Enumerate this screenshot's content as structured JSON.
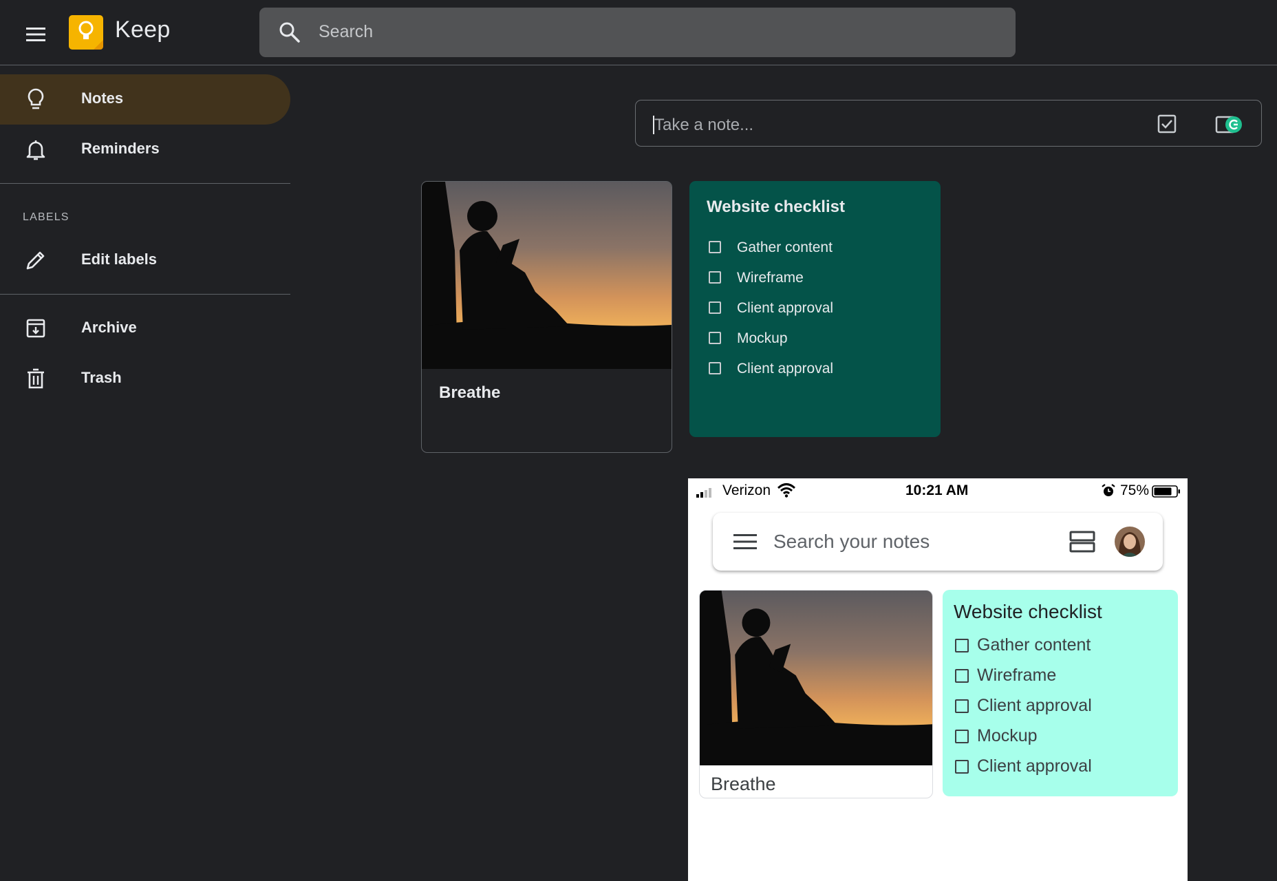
{
  "header": {
    "app_title": "Keep",
    "search_placeholder": "Search"
  },
  "sidebar": {
    "items": [
      {
        "label": "Notes",
        "icon": "lightbulb-icon",
        "active": true
      },
      {
        "label": "Reminders",
        "icon": "bell-icon"
      },
      {
        "label": "Edit labels",
        "icon": "pencil-icon"
      },
      {
        "label": "Archive",
        "icon": "archive-icon"
      },
      {
        "label": "Trash",
        "icon": "trash-icon"
      }
    ],
    "labels_heading": "LABELS"
  },
  "take_note": {
    "placeholder": "Take a note..."
  },
  "notes": [
    {
      "title": "Breathe",
      "image": "silhouette-reading-sunset"
    },
    {
      "title": "Website checklist",
      "color": "#045349",
      "items": [
        "Gather content",
        "Wireframe",
        "Client approval",
        "Mockup",
        "Client approval"
      ]
    }
  ],
  "mobile": {
    "status": {
      "carrier": "Verizon",
      "time": "10:21 AM",
      "battery": "75%"
    },
    "search_placeholder": "Search your notes",
    "notes": [
      {
        "title": "Breathe"
      },
      {
        "title": "Website checklist",
        "color": "#a7ffeb",
        "items": [
          "Gather content",
          "Wireframe",
          "Client approval",
          "Mockup",
          "Client approval"
        ]
      }
    ]
  },
  "colors": {
    "background": "#202124",
    "active_nav": "#41331c",
    "logo_yellow": "#f6b400",
    "accent_green": "#1fbf8f"
  }
}
